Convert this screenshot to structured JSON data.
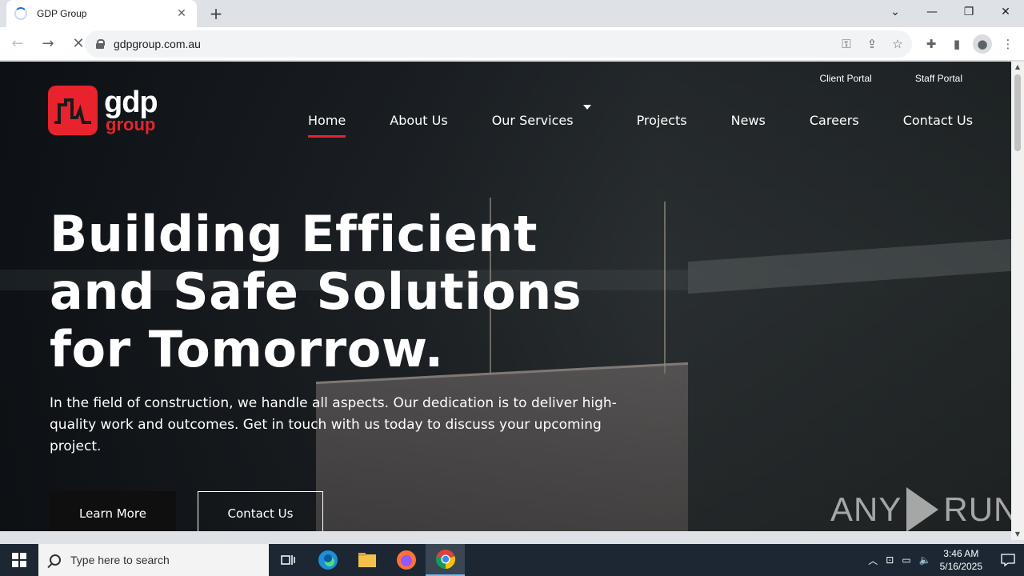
{
  "browser": {
    "tab_title": "GDP Group",
    "new_tab": "+",
    "tab_close": "✕",
    "url": "gdpgroup.com.au"
  },
  "site": {
    "logo_gdp": "gdp",
    "logo_group": "group",
    "top_links": [
      "Client Portal",
      "Staff Portal"
    ],
    "nav": [
      {
        "label": "Home",
        "active": true
      },
      {
        "label": "About Us"
      },
      {
        "label": "Our Services",
        "dropdown": true
      },
      {
        "label": "Projects"
      },
      {
        "label": "News"
      },
      {
        "label": "Careers"
      },
      {
        "label": "Contact Us"
      }
    ],
    "hero_lines": [
      "Building Efficient",
      "and Safe Solutions",
      "for Tomorrow."
    ],
    "hero_text": "In the field of construction, we handle all aspects. Our dedication is to deliver high-quality work and outcomes. Get in touch with us today to discuss your upcoming project.",
    "btn_learn": "Learn More",
    "btn_contact": "Contact Us",
    "brand_red": "#e8232d"
  },
  "watermark": {
    "left": "ANY",
    "right": "RUN"
  },
  "taskbar": {
    "search_placeholder": "Type here to search",
    "time": "3:46 AM",
    "date": "5/16/2025"
  }
}
